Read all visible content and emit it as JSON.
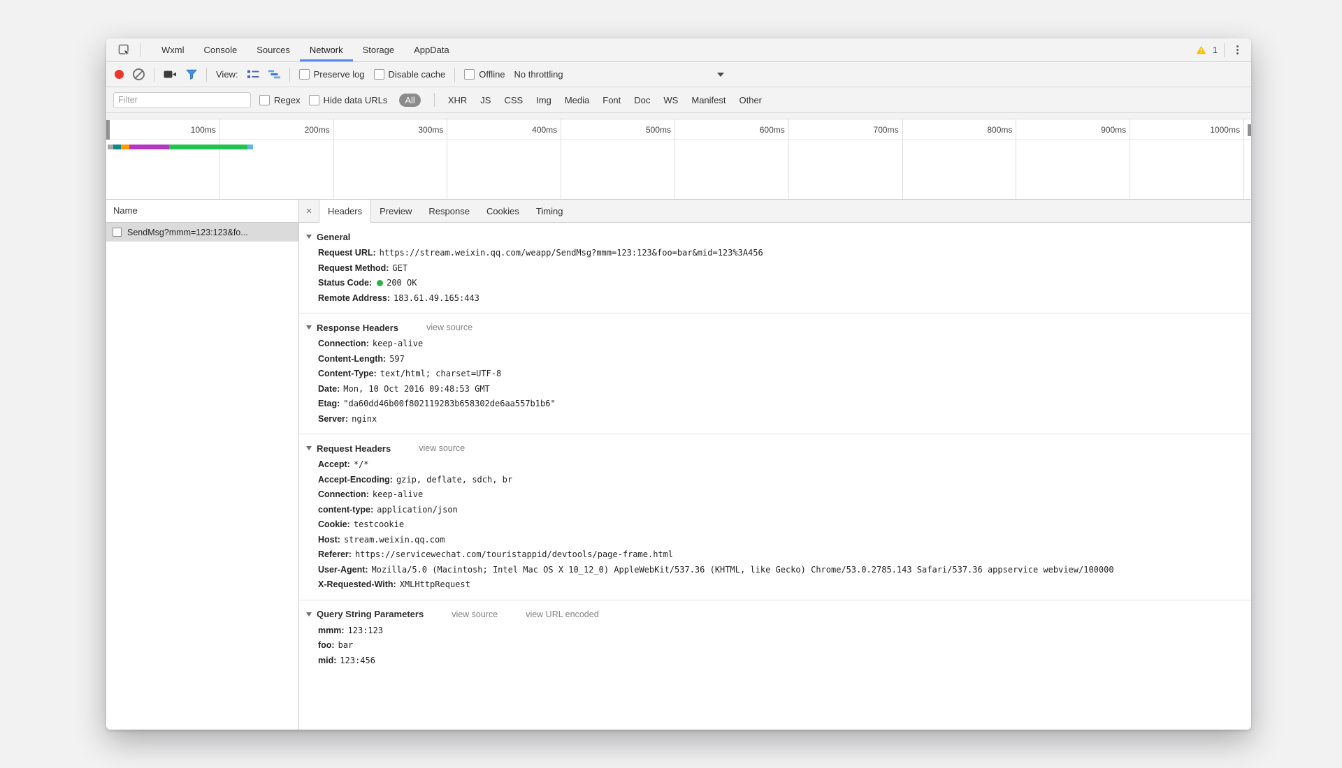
{
  "tabbar": {
    "tabs": [
      {
        "label": "Wxml",
        "active": false
      },
      {
        "label": "Console",
        "active": false
      },
      {
        "label": "Sources",
        "active": false
      },
      {
        "label": "Network",
        "active": true
      },
      {
        "label": "Storage",
        "active": false
      },
      {
        "label": "AppData",
        "active": false
      }
    ],
    "warning_count": "1"
  },
  "toolbar": {
    "view_label": "View:",
    "preserve_log": "Preserve log",
    "disable_cache": "Disable cache",
    "offline": "Offline",
    "throttling": "No throttling"
  },
  "filter_bar": {
    "placeholder": "Filter",
    "regex": "Regex",
    "hide_data_urls": "Hide data URLs",
    "types": [
      "All",
      "XHR",
      "JS",
      "CSS",
      "Img",
      "Media",
      "Font",
      "Doc",
      "WS",
      "Manifest",
      "Other"
    ],
    "active_type": "All"
  },
  "overview": {
    "ticks": [
      "100ms",
      "200ms",
      "300ms",
      "400ms",
      "500ms",
      "600ms",
      "700ms",
      "800ms",
      "900ms",
      "1000ms"
    ],
    "segments": [
      {
        "phase": "queueing",
        "color": "#a8a8a8",
        "width": 8
      },
      {
        "phase": "dns-lookup",
        "color": "#0e8988",
        "width": 11
      },
      {
        "phase": "initial-connection",
        "color": "#ff9d00",
        "width": 12
      },
      {
        "phase": "ssl",
        "color": "#b236bf",
        "width": 57
      },
      {
        "phase": "waiting-ttfb",
        "color": "#21c24f",
        "width": 112
      },
      {
        "phase": "content-download",
        "color": "#63b4ee",
        "width": 8
      }
    ]
  },
  "request_list": {
    "header": "Name",
    "rows": [
      {
        "name": "SendMsg?mmm=123:123&fo..."
      }
    ]
  },
  "details": {
    "close_label": "×",
    "tabs": [
      {
        "label": "Headers",
        "active": true
      },
      {
        "label": "Preview",
        "active": false
      },
      {
        "label": "Response",
        "active": false
      },
      {
        "label": "Cookies",
        "active": false
      },
      {
        "label": "Timing",
        "active": false
      }
    ],
    "status_dot_color": "#2db342",
    "sections": [
      {
        "title": "General",
        "links": [],
        "fields": [
          {
            "key": "Request URL:",
            "value": "https://stream.weixin.qq.com/weapp/SendMsg?mmm=123:123&foo=bar&mid=123%3A456"
          },
          {
            "key": "Request Method:",
            "value": "GET"
          },
          {
            "key": "Status Code:",
            "value": "200 OK",
            "dot": true
          },
          {
            "key": "Remote Address:",
            "value": "183.61.49.165:443"
          }
        ]
      },
      {
        "title": "Response Headers",
        "links": [
          "view source"
        ],
        "fields": [
          {
            "key": "Connection:",
            "value": "keep-alive"
          },
          {
            "key": "Content-Length:",
            "value": "597"
          },
          {
            "key": "Content-Type:",
            "value": "text/html; charset=UTF-8"
          },
          {
            "key": "Date:",
            "value": "Mon, 10 Oct 2016 09:48:53 GMT"
          },
          {
            "key": "Etag:",
            "value": "\"da60dd46b00f802119283b658302de6aa557b1b6\""
          },
          {
            "key": "Server:",
            "value": "nginx"
          }
        ]
      },
      {
        "title": "Request Headers",
        "links": [
          "view source"
        ],
        "fields": [
          {
            "key": "Accept:",
            "value": "*/*"
          },
          {
            "key": "Accept-Encoding:",
            "value": "gzip, deflate, sdch, br"
          },
          {
            "key": "Connection:",
            "value": "keep-alive"
          },
          {
            "key": "content-type:",
            "value": "application/json"
          },
          {
            "key": "Cookie:",
            "value": "testcookie"
          },
          {
            "key": "Host:",
            "value": "stream.weixin.qq.com"
          },
          {
            "key": "Referer:",
            "value": "https://servicewechat.com/touristappid/devtools/page-frame.html"
          },
          {
            "key": "User-Agent:",
            "value": "Mozilla/5.0 (Macintosh; Intel Mac OS X 10_12_0) AppleWebKit/537.36 (KHTML, like Gecko) Chrome/53.0.2785.143 Safari/537.36 appservice webview/100000"
          },
          {
            "key": "X-Requested-With:",
            "value": "XMLHttpRequest"
          }
        ]
      },
      {
        "title": "Query String Parameters",
        "links": [
          "view source",
          "view URL encoded"
        ],
        "fields": [
          {
            "key": "mmm:",
            "value": "123:123"
          },
          {
            "key": "foo:",
            "value": "bar"
          },
          {
            "key": "mid:",
            "value": "123:456"
          }
        ]
      }
    ]
  }
}
